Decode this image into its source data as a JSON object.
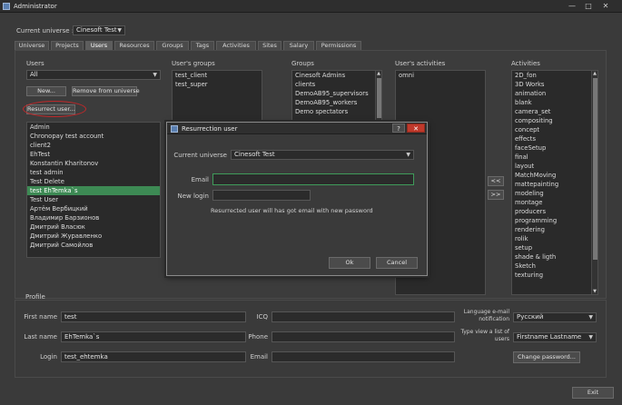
{
  "window": {
    "title": "Administrator",
    "min": "—",
    "max": "□",
    "close": "✕"
  },
  "top": {
    "universe_label": "Current universe :",
    "universe_value": "Cinesoft Test"
  },
  "tabs": [
    "Universe",
    "Projects",
    "Users",
    "Resources",
    "Groups",
    "Tags",
    "Activities",
    "Sites",
    "Salary",
    "Permissions"
  ],
  "active_tab": "Users",
  "users": {
    "label": "Users",
    "filter": "All",
    "new_btn": "New...",
    "remove_btn": "Remove from universe",
    "resurrect_btn": "Resurrect user...",
    "items": [
      "Admin",
      "Chronopay test account",
      "client2",
      "EhTest",
      "Konstantin Kharitonov",
      "test admin",
      "Test Delete",
      "test EhTemka`s",
      "Test User",
      "Артём Вербицкий",
      "Владимир Барзионов",
      "Дмитрий Власюк",
      "Дмитрий Журавленко",
      "Дмитрий Самойлов"
    ],
    "selected": "test EhTemka`s"
  },
  "user_groups": {
    "label": "User's groups",
    "items": [
      "test_client",
      "test_super"
    ]
  },
  "groups": {
    "label": "Groups",
    "items": [
      "Cinesoft Admins",
      "clients",
      "DemoAB95_supervisors",
      "DemoAB95_workers",
      "Demo spectators"
    ]
  },
  "user_activities": {
    "label": "User's activities",
    "items": [
      "omni"
    ]
  },
  "move": {
    "left": "<<",
    "right": ">>"
  },
  "activities": {
    "label": "Activities",
    "items": [
      "2D_fon",
      "3D Works",
      "animation",
      "blank",
      "camera_set",
      "compositing",
      "concept",
      "effects",
      "faceSetup",
      "final",
      "layout",
      "MatchMoving",
      "mattepainting",
      "modeling",
      "montage",
      "producers",
      "programming",
      "rendering",
      "rolik",
      "setup",
      "shade & ligth",
      "Sketch",
      "texturing"
    ]
  },
  "profile": {
    "label": "Profile",
    "firstname_label": "First name",
    "firstname": "test",
    "lastname_label": "Last name",
    "lastname": "EhTemka`s",
    "login_label": "Login",
    "login": "test_ehtemka",
    "icq_label": "ICQ",
    "icq": "",
    "phone_label": "Phone",
    "phone": "",
    "email_label": "Email",
    "email": "",
    "lang_label": "Language e-mail notification",
    "lang_value": "Русский",
    "view_label": "Type view a list of users",
    "view_value": "Firstname Lastname",
    "change_pw": "Change password..."
  },
  "exit": "Exit",
  "dialog": {
    "title": "Resurrection user",
    "help": "?",
    "close": "✕",
    "universe_label": "Current universe",
    "universe_value": "Cinesoft Test",
    "email_label": "Email",
    "email_value": "",
    "newlogin_label": "New login",
    "newlogin_value": "",
    "info": "Resurrected user will has got email with new password",
    "ok": "Ok",
    "cancel": "Cancel"
  }
}
